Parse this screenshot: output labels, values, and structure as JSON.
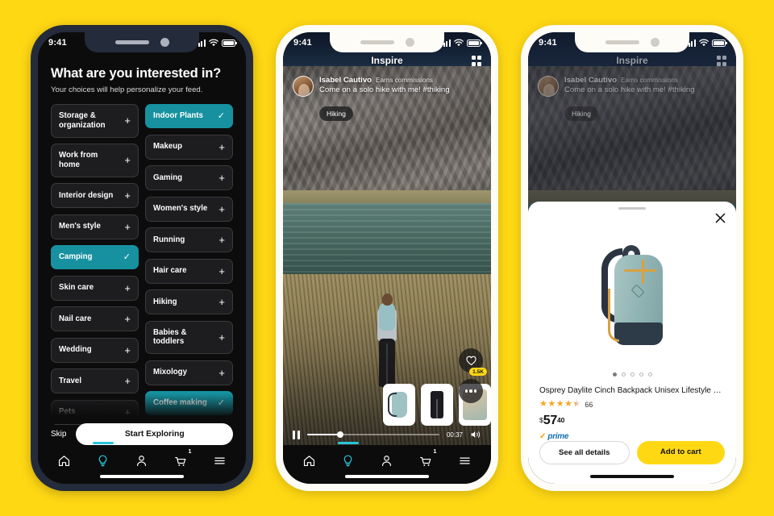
{
  "background_color": "#FFD814",
  "accent_teal": "#17919f",
  "accent_yellow": "#FFD814",
  "phone1": {
    "status": {
      "time": "9:41",
      "signal_icon": "signal-bars-icon",
      "wifi_icon": "wifi-icon",
      "battery_icon": "battery-icon"
    },
    "title": "What are you interested in?",
    "subtitle": "Your choices will help personalize your feed.",
    "chips_left": [
      {
        "label": "Storage & organization",
        "selected": false,
        "action": "+"
      },
      {
        "label": "Work from home",
        "selected": false,
        "action": "+"
      },
      {
        "label": "Interior design",
        "selected": false,
        "action": "+"
      },
      {
        "label": "Men's style",
        "selected": false,
        "action": "+"
      },
      {
        "label": "Camping",
        "selected": true,
        "action": "✓"
      },
      {
        "label": "Skin care",
        "selected": false,
        "action": "+"
      },
      {
        "label": "Nail care",
        "selected": false,
        "action": "+"
      },
      {
        "label": "Wedding",
        "selected": false,
        "action": "+"
      },
      {
        "label": "Travel",
        "selected": false,
        "action": "+"
      },
      {
        "label": "Pets",
        "selected": false,
        "action": "+"
      }
    ],
    "chips_right": [
      {
        "label": "Indoor Plants",
        "selected": true,
        "action": "✓"
      },
      {
        "label": "Makeup",
        "selected": false,
        "action": "+"
      },
      {
        "label": "Gaming",
        "selected": false,
        "action": "+"
      },
      {
        "label": "Women's style",
        "selected": false,
        "action": "+"
      },
      {
        "label": "Running",
        "selected": false,
        "action": "+"
      },
      {
        "label": "Hair care",
        "selected": false,
        "action": "+"
      },
      {
        "label": "Hiking",
        "selected": false,
        "action": "+"
      },
      {
        "label": "Babies & toddlers",
        "selected": false,
        "action": "+"
      },
      {
        "label": "Mixology",
        "selected": false,
        "action": "+"
      },
      {
        "label": "Coffee making",
        "selected": true,
        "action": "✓"
      }
    ],
    "skip_label": "Skip",
    "start_label": "Start Exploring",
    "tabbar": {
      "items": [
        {
          "icon": "home-icon",
          "active": false
        },
        {
          "icon": "inspire-bulb-icon",
          "active": true
        },
        {
          "icon": "account-person-icon",
          "active": false
        },
        {
          "icon": "cart-icon",
          "active": false,
          "badge": "1"
        },
        {
          "icon": "menu-hamburger-icon",
          "active": false
        }
      ]
    }
  },
  "phone2": {
    "status": {
      "time": "9:41"
    },
    "header_title": "Inspire",
    "grid_icon": "grid-view-icon",
    "creator": {
      "name": "Isabel Cautivo",
      "commission_note": "Earns commissions",
      "caption": "Come on a solo hike with me! #thiking",
      "avatar": "creator-avatar"
    },
    "tag": "Hiking",
    "like": {
      "icon": "heart-icon",
      "count": "1.5K"
    },
    "more_icon": "more-options-icon",
    "products_rail": [
      {
        "name": "backpack-thumbnail"
      },
      {
        "name": "pants-thumbnail"
      },
      {
        "name": "apparel-thumbnail"
      }
    ],
    "player": {
      "pause_icon": "pause-icon",
      "progress_percent": 25,
      "time": "00:37",
      "volume_icon": "volume-on-icon"
    },
    "tabbar": {
      "items": [
        {
          "icon": "home-icon",
          "active": false
        },
        {
          "icon": "inspire-bulb-icon",
          "active": true
        },
        {
          "icon": "account-person-icon",
          "active": false
        },
        {
          "icon": "cart-icon",
          "active": false,
          "badge": "1"
        },
        {
          "icon": "menu-hamburger-icon",
          "active": false
        }
      ]
    }
  },
  "phone3": {
    "status": {
      "time": "9:41"
    },
    "header_title": "Inspire",
    "grid_icon": "grid-view-icon",
    "creator": {
      "name": "Isabel Cautivo",
      "commission_note": "Earns commissions",
      "caption": "Come on a solo hike with me! #thiking"
    },
    "tag": "Hiking",
    "sheet": {
      "close_icon": "close-icon",
      "grabber": "sheet-drag-handle",
      "image_alt": "osprey-daylite-backpack-image",
      "carousel_dots": 5,
      "carousel_active": 0,
      "title": "Osprey Daylite Cinch Backpack Unisex Lifestyle Back...",
      "rating_stars": 4.5,
      "rating_count": "66",
      "price_currency": "$",
      "price_whole": "57",
      "price_fraction": "40",
      "prime_label": "prime",
      "buttons": {
        "details_label": "See all details",
        "cart_label": "Add to cart"
      }
    }
  }
}
